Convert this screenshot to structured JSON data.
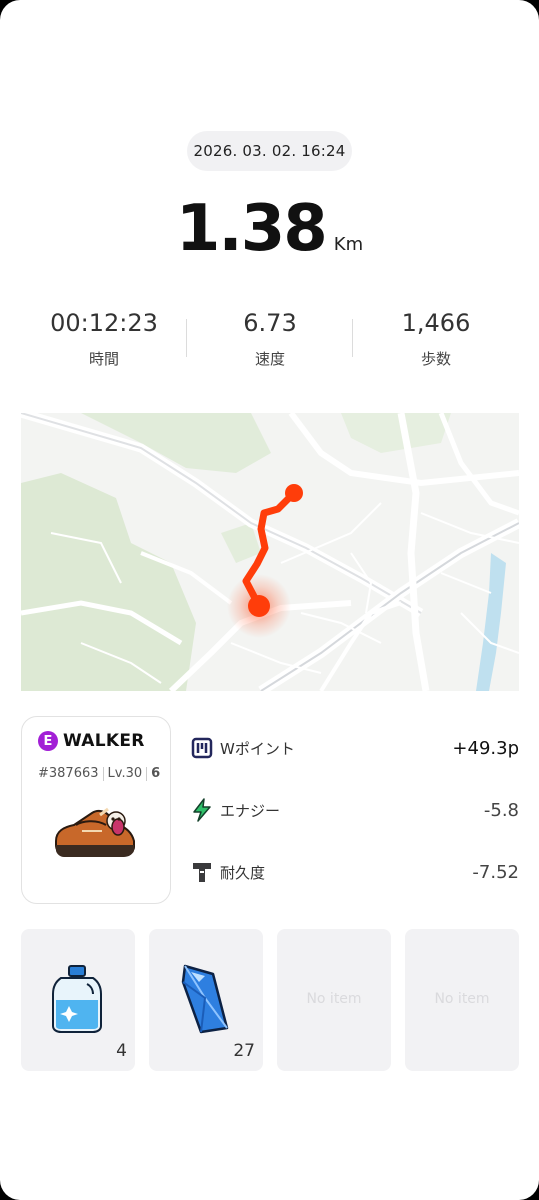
{
  "activity": {
    "datetime": "2026. 03. 02. 16:24",
    "distance": "1.38",
    "distance_unit": "Km"
  },
  "stats": [
    {
      "value": "00:12:23",
      "label": "時間"
    },
    {
      "value": "6.73",
      "label": "速度"
    },
    {
      "value": "1,466",
      "label": "歩数"
    }
  ],
  "colors": {
    "route": "#ff3d0a",
    "accent_purple": "#a21fd6"
  },
  "walker": {
    "badge": "E",
    "name": "WALKER",
    "id": "#387663",
    "level": "Lv.30",
    "extra_icon": "6"
  },
  "rewards": [
    {
      "icon": "w-point-icon",
      "label": "Wポイント",
      "value": "+49.3p"
    },
    {
      "icon": "energy-bolt-icon",
      "label": "エナジー",
      "value": "-5.8"
    },
    {
      "icon": "durability-icon",
      "label": "耐久度",
      "value": "-7.52"
    }
  ],
  "items": [
    {
      "icon": "detergent-bottle-icon",
      "count": "4"
    },
    {
      "icon": "blue-crystal-icon",
      "count": "27"
    },
    {
      "empty_label": "No item"
    },
    {
      "empty_label": "No item"
    }
  ]
}
